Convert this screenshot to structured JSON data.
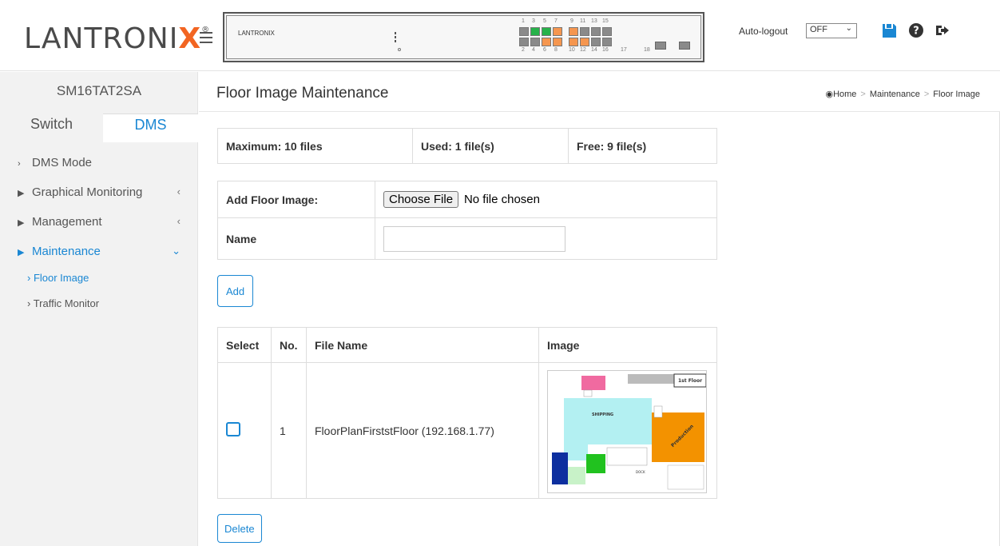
{
  "header": {
    "logo_text": "LANTRONIX",
    "logo_mark": "®",
    "device_brand": "LANTRONIX",
    "port_numbers_top": [
      "1",
      "3",
      "5",
      "7",
      "9",
      "11",
      "13",
      "15"
    ],
    "port_numbers_bottom": [
      "2",
      "4",
      "6",
      "8",
      "10",
      "12",
      "14",
      "16",
      "17",
      "18"
    ],
    "autologout_label": "Auto-logout",
    "autologout_value": "OFF",
    "icons": [
      "menu-icon",
      "save-icon",
      "help-icon",
      "logout-icon"
    ],
    "colors": {
      "port_link": "#27b24a",
      "port_poe": "#f5964f",
      "port_off": "#8a8a8a",
      "accent": "#1a87d3"
    }
  },
  "sidebar": {
    "device_name": "SM16TAT2SA",
    "tabs": [
      {
        "label": "Switch",
        "active": false
      },
      {
        "label": "DMS",
        "active": true
      }
    ],
    "items": [
      {
        "label": "DMS Mode"
      },
      {
        "label": "Graphical Monitoring"
      },
      {
        "label": "Management"
      },
      {
        "label": "Maintenance",
        "expanded": true
      }
    ],
    "subitems": [
      {
        "label": "Floor Image",
        "active": true
      },
      {
        "label": "Traffic Monitor",
        "active": false
      }
    ]
  },
  "main": {
    "title": "Floor Image Maintenance",
    "breadcrumb": [
      "Home",
      "Maintenance",
      "Floor Image"
    ],
    "stats": {
      "maximum": "Maximum: 10 files",
      "used": "Used: 1 file(s)",
      "free": "Free: 9 file(s)"
    },
    "add_form": {
      "add_label": "Add Floor Image:",
      "choose_file_label": "Choose File",
      "file_status": "No file chosen",
      "name_label": "Name",
      "name_value": ""
    },
    "add_button": "Add",
    "files_table": {
      "columns": [
        "Select",
        "No.",
        "File Name",
        "Image"
      ],
      "rows": [
        {
          "no": "1",
          "file_name": "FloorPlanFirststFloor (192.168.1.77)",
          "checked": false
        }
      ]
    },
    "thumbnail_text": {
      "floor": "1st Floor",
      "shipping": "SHIPPING",
      "production": "Production",
      "dock": "DOCK"
    },
    "delete_button": "Delete"
  }
}
